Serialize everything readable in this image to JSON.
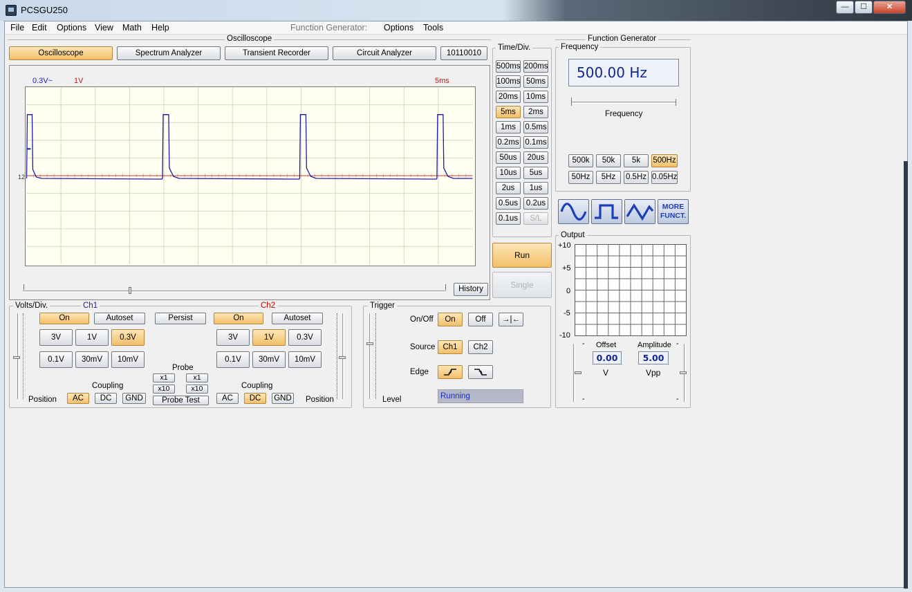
{
  "window": {
    "title": "PCSGU250",
    "btn_min": "—",
    "btn_max": "☐",
    "btn_close": "✕"
  },
  "menu": {
    "items": [
      "File",
      "Edit",
      "Options",
      "View",
      "Math",
      "Help"
    ],
    "fg_label": "Function Generator:",
    "fg_items": [
      "Options",
      "Tools"
    ]
  },
  "oscilloscope": {
    "group_label": "Oscilloscope",
    "modes": [
      "Oscilloscope",
      "Spectrum Analyzer",
      "Transient Recorder",
      "Circuit Analyzer",
      "10110010"
    ],
    "selected_mode": "Oscilloscope",
    "screen": {
      "ch1_volts": "0.3V~",
      "ch2_volts": "1V",
      "time_div": "5ms",
      "marker_label": "12",
      "ch1_color": "#1a1a9e",
      "ch2_color": "#c0392b"
    },
    "history_label": "History"
  },
  "timediv": {
    "label": "Time/Div.",
    "buttons": [
      "500ms",
      "200ms",
      "100ms",
      "50ms",
      "20ms",
      "10ms",
      "5ms",
      "2ms",
      "1ms",
      "0.5ms",
      "0.2ms",
      "0.1ms",
      "50us",
      "20us",
      "10us",
      "5us",
      "2us",
      "1us",
      "0.5us",
      "0.2us",
      "0.1us",
      "S/L"
    ],
    "selected": "5ms",
    "disabled": "S/L",
    "run": "Run",
    "single": "Single"
  },
  "volts": {
    "label": "Volts/Div.",
    "ch1": {
      "label": "Ch1",
      "on": "On",
      "autoset": "Autoset",
      "ranges": [
        "3V",
        "1V",
        "0.3V",
        "0.1V",
        "30mV",
        "10mV"
      ],
      "selected_range": "0.3V",
      "coupling_label": "Coupling",
      "coupling": [
        "AC",
        "DC",
        "GND"
      ],
      "selected_coupling": "AC",
      "position": "Position"
    },
    "persist": "Persist",
    "probe": {
      "label": "Probe",
      "x1_a": "x1",
      "x1_b": "x1",
      "x10_a": "x10",
      "x10_b": "x10",
      "test": "Probe Test"
    },
    "ch2": {
      "label": "Ch2",
      "on": "On",
      "autoset": "Autoset",
      "ranges": [
        "3V",
        "1V",
        "0.3V",
        "0.1V",
        "30mV",
        "10mV"
      ],
      "selected_range": "1V",
      "coupling_label": "Coupling",
      "coupling": [
        "AC",
        "DC",
        "GND"
      ],
      "selected_coupling": "DC",
      "position": "Position"
    }
  },
  "trigger": {
    "label": "Trigger",
    "onoff_label": "On/Off",
    "on": "On",
    "off": "Off",
    "center_icon": "→|←",
    "source_label": "Source",
    "ch1": "Ch1",
    "ch2": "Ch2",
    "edge_label": "Edge",
    "level_label": "Level",
    "status": "Running"
  },
  "funcgen": {
    "label": "Function Generator",
    "frequency_label": "Frequency",
    "display": "500.00 Hz",
    "slider_label": "Frequency",
    "ranges": [
      "500k",
      "50k",
      "5k",
      "500Hz",
      "50Hz",
      "5Hz",
      "0.5Hz",
      "0.05Hz"
    ],
    "selected_range": "500Hz",
    "more_line1": "MORE",
    "more_line2": "FUNCT.",
    "output_label": "Output",
    "y_ticks": [
      "+10",
      "+5",
      "0",
      "-5",
      "-10"
    ],
    "offset_label": "Offset",
    "offset_value": "0.00",
    "offset_unit": "V",
    "amplitude_label": "Amplitude",
    "amplitude_value": "5.00",
    "amplitude_unit": "Vpp"
  }
}
